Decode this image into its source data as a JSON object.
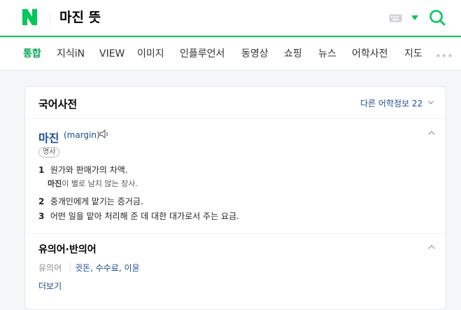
{
  "header": {
    "query": "마진 뜻",
    "brand_color": "#03c75a"
  },
  "tabs": [
    {
      "label": "통합",
      "active": true
    },
    {
      "label": "지식iN"
    },
    {
      "label": "VIEW"
    },
    {
      "label": "이미지"
    },
    {
      "label": "인플루언서"
    },
    {
      "label": "동영상"
    },
    {
      "label": "쇼핑"
    },
    {
      "label": "뉴스"
    },
    {
      "label": "어학사전"
    },
    {
      "label": "지도"
    }
  ],
  "dictionary": {
    "title": "국어사전",
    "other_info_link": "다른 어학정보 22",
    "entry": {
      "word": "마진",
      "origin": "(margin)",
      "pos": "명사",
      "definitions": [
        {
          "num": "1",
          "text": "원가와 판매가의 차액.",
          "example_word": "마진",
          "example_rest": "이 별로 남지 않는 장사."
        },
        {
          "num": "2",
          "text": "중개인에게 맡기는 증거금."
        },
        {
          "num": "3",
          "text": "어떤 일을 맡아 처리해 준 데 대한 대가로서 주는 요금."
        }
      ]
    },
    "synonyms": {
      "title": "유의어·반의어",
      "label": "유의어",
      "value": "귓돈, 수수료, 이윤",
      "more": "더보기"
    }
  },
  "icons": {
    "keyboard": "keyboard-icon",
    "search": "search-icon",
    "speaker": "speaker-icon",
    "collapse": "chevron-up-icon"
  }
}
